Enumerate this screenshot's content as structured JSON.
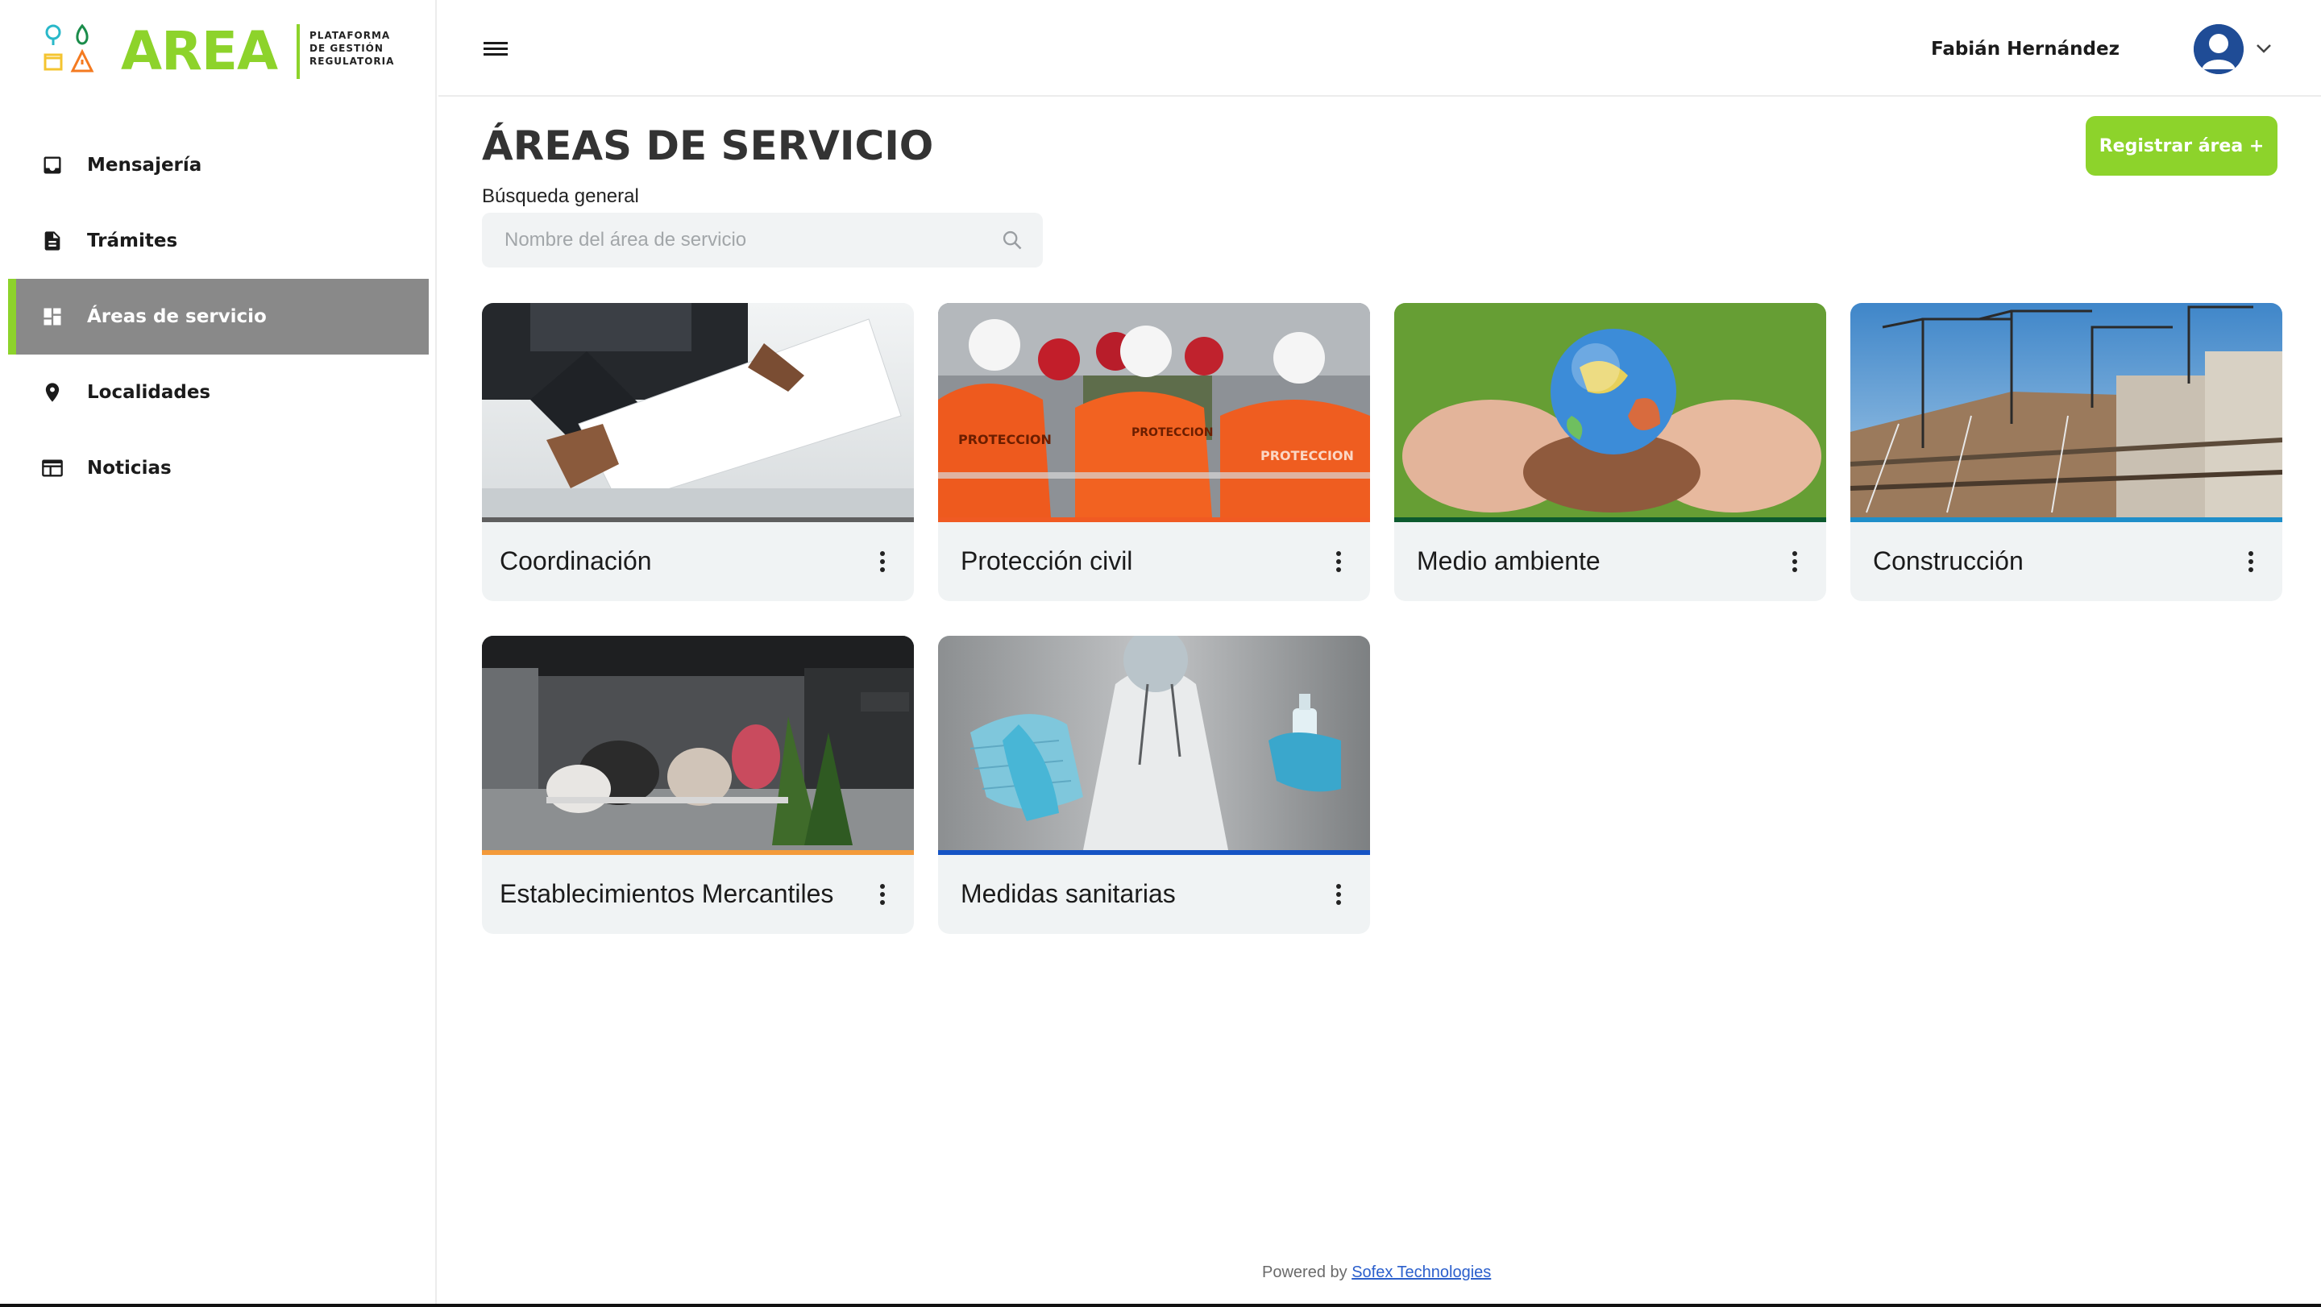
{
  "app": {
    "logo_word": "AREA",
    "logo_subtitle": [
      "PLATAFORMA",
      "DE GESTIÓN",
      "REGULATORIA"
    ],
    "brand_color": "#8dd32b"
  },
  "sidebar": {
    "items": [
      {
        "label": "Mensajería",
        "icon": "inbox-icon",
        "active": false
      },
      {
        "label": "Trámites",
        "icon": "document-icon",
        "active": false
      },
      {
        "label": "Áreas de servicio",
        "icon": "dashboard-icon",
        "active": true
      },
      {
        "label": "Localidades",
        "icon": "location-pin-icon",
        "active": false
      },
      {
        "label": "Noticias",
        "icon": "news-icon",
        "active": false
      }
    ]
  },
  "header": {
    "user_name": "Fabián Hernández",
    "menu_icon": "hamburger-menu-icon",
    "dropdown_icon": "chevron-down-icon"
  },
  "main": {
    "title": "ÁREAS DE SERVICIO",
    "register_button": "Registrar área +",
    "search": {
      "label": "Búsqueda general",
      "placeholder": "Nombre del área de servicio",
      "value": ""
    },
    "cards": [
      {
        "label": "Coordinación",
        "bar_color": "#5f5f5f",
        "image": "business-documents"
      },
      {
        "label": "Protección civil",
        "bar_color": "#f05a23",
        "image": "civil-protection-team"
      },
      {
        "label": "Medio ambiente",
        "bar_color": "#0c5a2e",
        "image": "hands-holding-globe"
      },
      {
        "label": "Construcción",
        "bar_color": "#1f8ec9",
        "image": "construction-cranes"
      },
      {
        "label": "Establecimientos Mercantiles",
        "bar_color": "#f39a3a",
        "image": "restaurant-terrace"
      },
      {
        "label": "Medidas sanitarias",
        "bar_color": "#1553c4",
        "image": "medical-mask-sanitizer"
      }
    ]
  },
  "footer": {
    "prefix": "Powered by",
    "link": "Sofex Technologies"
  }
}
